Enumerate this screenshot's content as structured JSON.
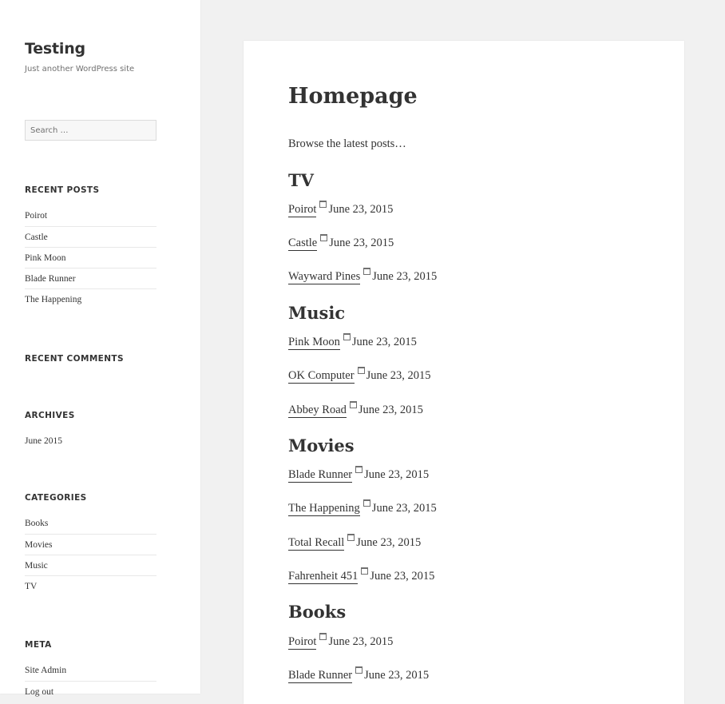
{
  "site": {
    "title": "Testing",
    "description": "Just another WordPress site"
  },
  "search": {
    "placeholder": "Search …"
  },
  "widgets": {
    "recent_posts": {
      "title": "RECENT POSTS",
      "items": [
        "Poirot",
        "Castle",
        "Pink Moon",
        "Blade Runner",
        "The Happening"
      ]
    },
    "recent_comments": {
      "title": "RECENT COMMENTS"
    },
    "archives": {
      "title": "ARCHIVES",
      "items": [
        "June 2015"
      ]
    },
    "categories": {
      "title": "CATEGORIES",
      "items": [
        "Books",
        "Movies",
        "Music",
        "TV"
      ]
    },
    "meta": {
      "title": "META",
      "items": [
        "Site Admin",
        "Log out"
      ]
    }
  },
  "main": {
    "title": "Homepage",
    "intro": "Browse the latest posts…",
    "sections": [
      {
        "title": "TV",
        "posts": [
          {
            "title": "Poirot",
            "date": "June 23, 2015"
          },
          {
            "title": "Castle",
            "date": "June 23, 2015"
          },
          {
            "title": "Wayward Pines",
            "date": "June 23, 2015"
          }
        ]
      },
      {
        "title": "Music",
        "posts": [
          {
            "title": "Pink Moon",
            "date": "June 23, 2015"
          },
          {
            "title": "OK Computer",
            "date": "June 23, 2015"
          },
          {
            "title": "Abbey Road",
            "date": "June 23, 2015"
          }
        ]
      },
      {
        "title": "Movies",
        "posts": [
          {
            "title": "Blade Runner",
            "date": "June 23, 2015"
          },
          {
            "title": "The Happening",
            "date": "June 23, 2015"
          },
          {
            "title": "Total Recall",
            "date": "June 23, 2015"
          },
          {
            "title": "Fahrenheit 451",
            "date": "June 23, 2015"
          }
        ]
      },
      {
        "title": "Books",
        "posts": [
          {
            "title": "Poirot",
            "date": "June 23, 2015"
          },
          {
            "title": "Blade Runner",
            "date": "June 23, 2015"
          }
        ]
      }
    ]
  },
  "icons": {
    "date": "calendar-icon"
  }
}
